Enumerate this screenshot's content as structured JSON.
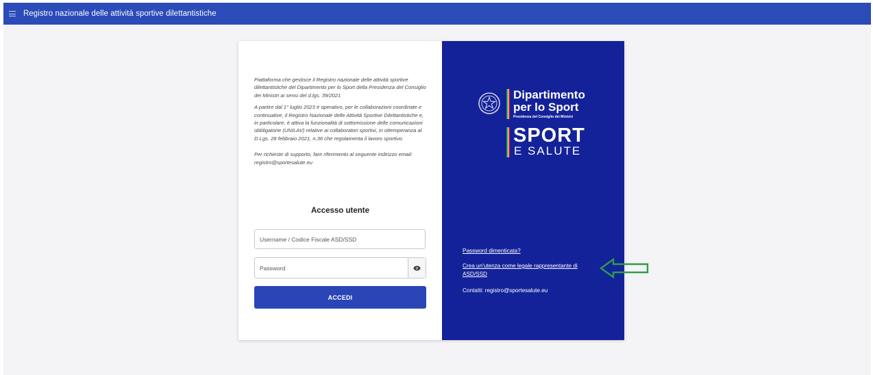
{
  "header": {
    "title": "Registro nazionale delle attività sportive dilettantistiche"
  },
  "intro": {
    "paragraph1": "Piattaforma che gestisce il Registro nazionale delle attività sportive dilettantistiche del Dipartimento per lo Sport della Presidenza del Consiglio dei Ministri ai sensi del d.lgs. 39/2021",
    "paragraph2": "A partire dal 1° luglio 2023 è operativo, per le collaborazioni coordinate e continuative, il Registro Nazionale delle Attività Sportive Dilettantistiche e, in particolare, è attiva la funzionalità di sottomissione delle comunicazioni obbligatorie (UNILAV) relative ai collaboratori sportivi, in ottemperanza al D.Lgs. 28 febbraio 2021, n.36 che regolamenta il lavoro sportivo.",
    "paragraph3": "Per richieste di supporto, fare riferimento al seguente indirizzo email: registro@sportesalute.eu"
  },
  "login": {
    "title": "Accesso utente",
    "username_placeholder": "Username / Codice Fiscale ASD/SSD",
    "password_placeholder": "Password",
    "submit_label": "ACCEDI",
    "password_toggle_icon": "eye-icon"
  },
  "branding": {
    "line1": "Dipartimento",
    "line2": "per lo Sport",
    "line3": "Presidenza del Consiglio dei Ministri",
    "line4": "SPORT",
    "line5": "E SALUTE",
    "emblem_icon": "italian-republic-emblem-icon",
    "colors": {
      "green": "#1f9a48",
      "white": "#ffffff",
      "red": "#d6322f",
      "panel": "#14229a"
    }
  },
  "links": {
    "forgot_password": "Password dimenticata?",
    "create_account": "Crea un'utenza come legale rappresentante di ASD/SSD",
    "contact": "Contatti: registro@sportesalute.eu"
  },
  "theme": {
    "topbar": "#2a4bb8",
    "button": "#2a45b6",
    "annotation_arrow": "#2e9e48"
  }
}
